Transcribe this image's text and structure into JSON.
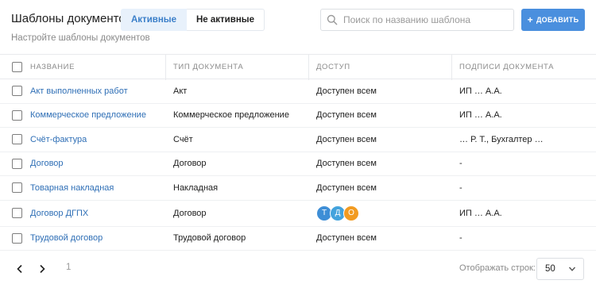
{
  "header": {
    "title": "Шаблоны документов",
    "subtitle": "Настройте шаблоны документов",
    "tabs": [
      {
        "label": "Активные",
        "active": true
      },
      {
        "label": "Не активные",
        "active": false
      }
    ],
    "search_placeholder": "Поиск по названию шаблона",
    "add_button_label": "ДОБАВИТЬ",
    "add_icon": "plus-icon",
    "search_icon": "search-icon"
  },
  "table": {
    "columns": [
      "НАЗВАНИЕ",
      "ТИП ДОКУМЕНТА",
      "ДОСТУП",
      "ПОДПИСИ ДОКУМЕНТА"
    ],
    "rows": [
      {
        "name": "Акт выполненных работ",
        "type": "Акт",
        "access": "Доступен всем",
        "signatures": "ИП … А.А."
      },
      {
        "name": "Коммерческое предложение",
        "type": "Коммерческое предложение",
        "access": "Доступен всем",
        "signatures": "ИП … А.А."
      },
      {
        "name": "Счёт-фактура",
        "type": "Счёт",
        "access": "Доступен всем",
        "signatures": "… Р. Т., Бухгалтер …"
      },
      {
        "name": "Договор",
        "type": "Договор",
        "access": "Доступен всем",
        "signatures": "-"
      },
      {
        "name": "Товарная накладная",
        "type": "Накладная",
        "access": "Доступен всем",
        "signatures": "-"
      },
      {
        "name": "Договор ДГПХ",
        "type": "Договор",
        "access": "",
        "avatars": [
          {
            "letter": "Т",
            "color": "#3e8ed6"
          },
          {
            "letter": "Д",
            "color": "#43a3dd"
          },
          {
            "letter": "О",
            "color": "#f29b21"
          }
        ],
        "signatures": "ИП … А.А."
      },
      {
        "name": "Трудовой договор",
        "type": "Трудовой договор",
        "access": "Доступен всем",
        "signatures": "-"
      }
    ]
  },
  "footer": {
    "current_page": "1",
    "rows_label": "Отображать строк:",
    "rows_value": "50"
  },
  "colors": {
    "accent": "#4a8fde",
    "link": "#2f6fb6",
    "active_tab_bg": "#e8f1fb"
  }
}
